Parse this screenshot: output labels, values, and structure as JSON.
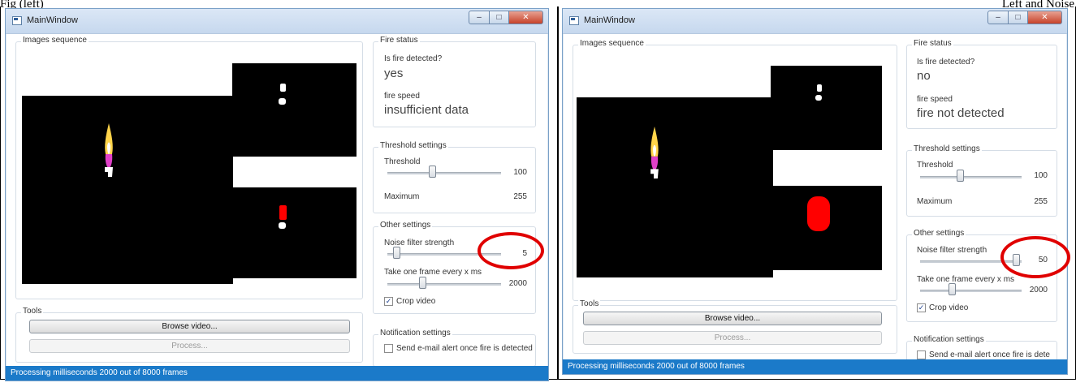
{
  "captions": {
    "left": "Fig (left)",
    "right": "Left and Noise"
  },
  "colors": {
    "status_bar": "#1b7ac9",
    "highlight_ring": "#e00000",
    "fire_mask": "#ff0000"
  },
  "windows": [
    {
      "title": "MainWindow",
      "images_sequence_label": "Images sequence",
      "fire_status": {
        "label": "Fire status",
        "question": "Is fire detected?",
        "answer": "yes",
        "speed_label": "fire speed",
        "speed_value": "insufficient data"
      },
      "threshold": {
        "label": "Threshold settings",
        "threshold_label": "Threshold",
        "threshold_value": "100",
        "threshold_level": 0.39,
        "maximum_label": "Maximum",
        "maximum_value": "255"
      },
      "other": {
        "label": "Other settings",
        "noise_label": "Noise filter strength",
        "noise_value": "5",
        "noise_level": 0.05,
        "frame_label": "Take one frame every x ms",
        "frame_value": "2000",
        "frame_level": 0.3,
        "crop_label": "Crop video",
        "crop_checked": true
      },
      "tools": {
        "label": "Tools",
        "browse": "Browse video...",
        "process": "Process..."
      },
      "notification": {
        "label": "Notification settings",
        "email_label": "Send e-mail alert once fire is detected"
      },
      "status": "Processing milliseconds 2000 out of 8000 frames"
    },
    {
      "title": "MainWindow",
      "images_sequence_label": "Images sequence",
      "fire_status": {
        "label": "Fire status",
        "question": "Is fire detected?",
        "answer": "no",
        "speed_label": "fire speed",
        "speed_value": "fire not detected"
      },
      "threshold": {
        "label": "Threshold settings",
        "threshold_label": "Threshold",
        "threshold_value": "100",
        "threshold_level": 0.39,
        "maximum_label": "Maximum",
        "maximum_value": "255"
      },
      "other": {
        "label": "Other settings",
        "noise_label": "Noise filter strength",
        "noise_value": "50",
        "noise_level": 0.98,
        "frame_label": "Take one frame every x ms",
        "frame_value": "2000",
        "frame_level": 0.3,
        "crop_label": "Crop video",
        "crop_checked": true
      },
      "tools": {
        "label": "Tools",
        "browse": "Browse video...",
        "process": "Process..."
      },
      "notification": {
        "label": "Notification settings",
        "email_label": "Send e-mail alert once fire is dete"
      },
      "status": "Processing milliseconds 2000 out of 8000 frames"
    }
  ]
}
